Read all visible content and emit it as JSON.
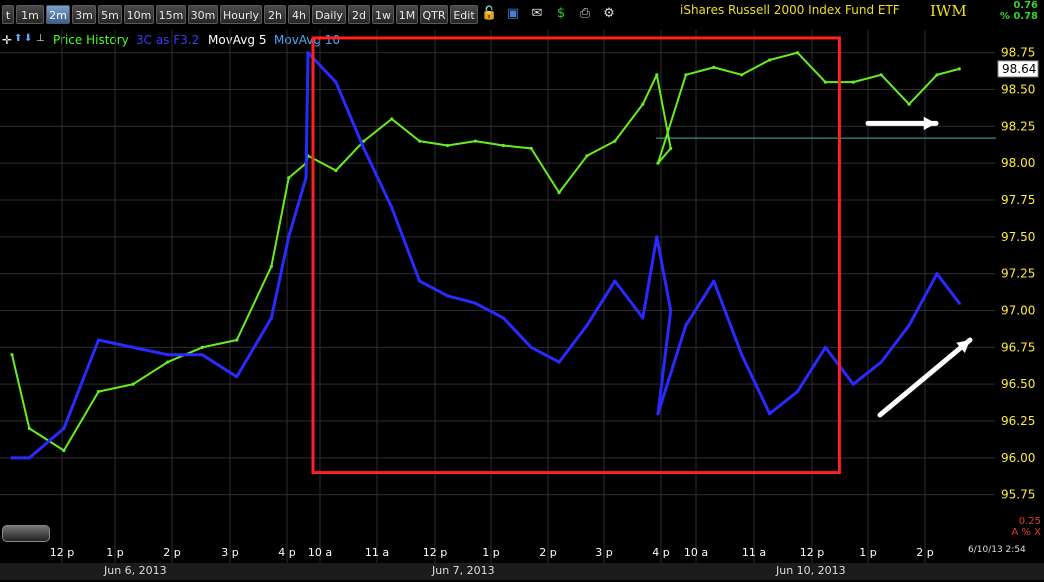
{
  "toolbar": {
    "timeframes": [
      "t",
      "1m",
      "2m",
      "3m",
      "5m",
      "10m",
      "15m",
      "30m",
      "Hourly",
      "2h",
      "4h",
      "Daily",
      "2d",
      "1w",
      "1M",
      "QTR",
      "Edit"
    ],
    "active": "2m",
    "icons": [
      "lock-icon",
      "save-icon",
      "mail-icon",
      "dollar-icon",
      "print-icon",
      "gear-icon"
    ]
  },
  "header": {
    "title": "iShares Russell 2000 Index Fund ETF",
    "symbol": "IWM",
    "change": "0.76",
    "change_pct": "% 0.78"
  },
  "legend": {
    "price": "Price History",
    "indicator": "3C as F3.2",
    "ma5": "MovAvg 5",
    "ma10": "MovAvg 10"
  },
  "colors": {
    "price": "#66ee22",
    "indicator": "#2a2aff",
    "box": "#ff2020",
    "grid": "#2e2e2e",
    "axis": "#ffe93a",
    "ref_line": "#3a8a8a",
    "arrow": "#ffffff"
  },
  "footer": {
    "dates": [
      "Jun 6, 2013",
      "Jun 7, 2013",
      "Jun 10, 2013"
    ],
    "timestamp": "6/10/13 2:54",
    "corner_top": "0.25",
    "corner_bottom": "A  % X"
  },
  "chart_data": {
    "type": "line",
    "title": "iShares Russell 2000 Index Fund ETF",
    "y_ticks": [
      "98.75",
      "98.50",
      "98.25",
      "98.00",
      "97.75",
      "97.50",
      "97.25",
      "97.00",
      "96.75",
      "96.50",
      "96.25",
      "96.00",
      "95.75"
    ],
    "ylim": [
      95.68,
      98.87
    ],
    "last_price_label": "98.64",
    "reference_level": 98.17,
    "x_ticks": [
      "12 p",
      "1 p",
      "2 p",
      "3 p",
      "4 p",
      "10 a",
      "11 a",
      "12 p",
      "1 p",
      "2 p",
      "3 p",
      "4 p",
      "10 a",
      "11 a",
      "12 p",
      "1 p",
      "2 p"
    ],
    "x": [
      "Jun 6 11:45",
      "Jun 6 12:00",
      "Jun 6 12:30",
      "Jun 6 13:00",
      "Jun 6 13:30",
      "Jun 6 14:00",
      "Jun 6 14:30",
      "Jun 6 15:00",
      "Jun 6 15:30",
      "Jun 6 15:45",
      "Jun 6 16:00",
      "Jun 7 09:30",
      "Jun 7 10:00",
      "Jun 7 10:30",
      "Jun 7 11:00",
      "Jun 7 11:30",
      "Jun 7 12:00",
      "Jun 7 12:30",
      "Jun 7 13:00",
      "Jun 7 13:30",
      "Jun 7 14:00",
      "Jun 7 14:30",
      "Jun 7 15:00",
      "Jun 7 15:30",
      "Jun 7 15:45",
      "Jun 7 16:00",
      "Jun 10 09:30",
      "Jun 10 10:00",
      "Jun 10 10:30",
      "Jun 10 11:00",
      "Jun 10 11:30",
      "Jun 10 12:00",
      "Jun 10 12:30",
      "Jun 10 13:00",
      "Jun 10 13:30",
      "Jun 10 14:00",
      "Jun 10 14:30",
      "Jun 10 14:54"
    ],
    "series": [
      {
        "name": "Price History",
        "values": [
          96.7,
          96.2,
          96.05,
          96.45,
          96.5,
          96.65,
          96.75,
          96.8,
          97.3,
          97.9,
          98.0,
          98.05,
          97.95,
          98.15,
          98.3,
          98.15,
          98.12,
          98.15,
          98.12,
          98.1,
          97.8,
          98.05,
          98.15,
          98.4,
          98.6,
          98.1,
          98.0,
          98.6,
          98.65,
          98.6,
          98.7,
          98.75,
          98.55,
          98.55,
          98.6,
          98.4,
          98.6,
          98.64
        ]
      },
      {
        "name": "3C as F3.2",
        "values": [
          96.0,
          96.0,
          96.2,
          96.8,
          96.75,
          96.7,
          96.7,
          96.55,
          96.95,
          97.5,
          97.9,
          98.75,
          98.55,
          98.1,
          97.7,
          97.2,
          97.1,
          97.05,
          96.95,
          96.75,
          96.65,
          96.9,
          97.2,
          96.95,
          97.5,
          97.0,
          96.3,
          96.9,
          97.2,
          96.7,
          96.3,
          96.45,
          96.75,
          96.5,
          96.65,
          96.9,
          97.25,
          97.05
        ]
      }
    ],
    "highlight_box": {
      "x_start": "Jun 7 09:30",
      "x_end": "Jun 10 12:30",
      "y_range": [
        95.9,
        98.85
      ]
    },
    "annotations": [
      {
        "type": "arrow",
        "direction": "right",
        "y": 98.27
      },
      {
        "type": "arrow",
        "direction": "up-right",
        "y": 96.8
      }
    ],
    "grid": true
  }
}
